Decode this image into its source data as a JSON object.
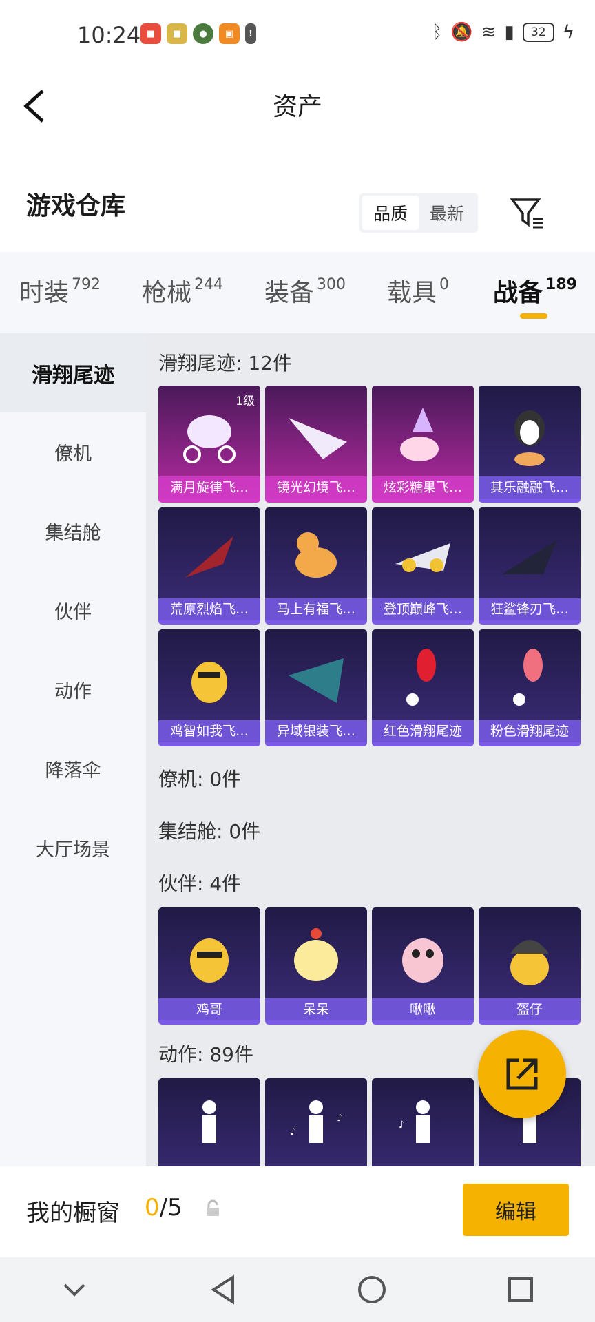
{
  "status": {
    "time": "10:24",
    "battery": "32"
  },
  "header": {
    "title": "资产"
  },
  "warehouse": {
    "title": "游戏仓库",
    "sort": [
      "品质",
      "最新"
    ]
  },
  "tabs": [
    {
      "label": "时装",
      "count": "792"
    },
    {
      "label": "枪械",
      "count": "244"
    },
    {
      "label": "装备",
      "count": "300"
    },
    {
      "label": "载具",
      "count": "0"
    },
    {
      "label": "战备",
      "count": "189"
    }
  ],
  "sidebar": [
    "滑翔尾迹",
    "僚机",
    "集结舱",
    "伙伴",
    "动作",
    "降落伞",
    "大厅场景"
  ],
  "sections": {
    "trail": {
      "title": "滑翔尾迹: 12件",
      "items": [
        "满月旋律飞…",
        "镜光幻境飞…",
        "炫彩糖果飞…",
        "其乐融融飞…",
        "荒原烈焰飞…",
        "马上有福飞…",
        "登顶巅峰飞…",
        "狂鲨锋刃飞…",
        "鸡智如我飞…",
        "异域银装飞…",
        "红色滑翔尾迹",
        "粉色滑翔尾迹"
      ],
      "level": "1级"
    },
    "wingman": {
      "title": "僚机: 0件"
    },
    "pod": {
      "title": "集结舱: 0件"
    },
    "partner": {
      "title": "伙伴: 4件",
      "items": [
        "鸡哥",
        "呆呆",
        "啾啾",
        "盔仔"
      ]
    },
    "emote": {
      "title": "动作: 89件"
    }
  },
  "bottom": {
    "label": "我的橱窗",
    "used": "0",
    "total": "/5",
    "edit": "编辑"
  },
  "colors": {
    "accent": "#f5b200",
    "card": "#2b2160",
    "epic": "#b52aa0"
  }
}
